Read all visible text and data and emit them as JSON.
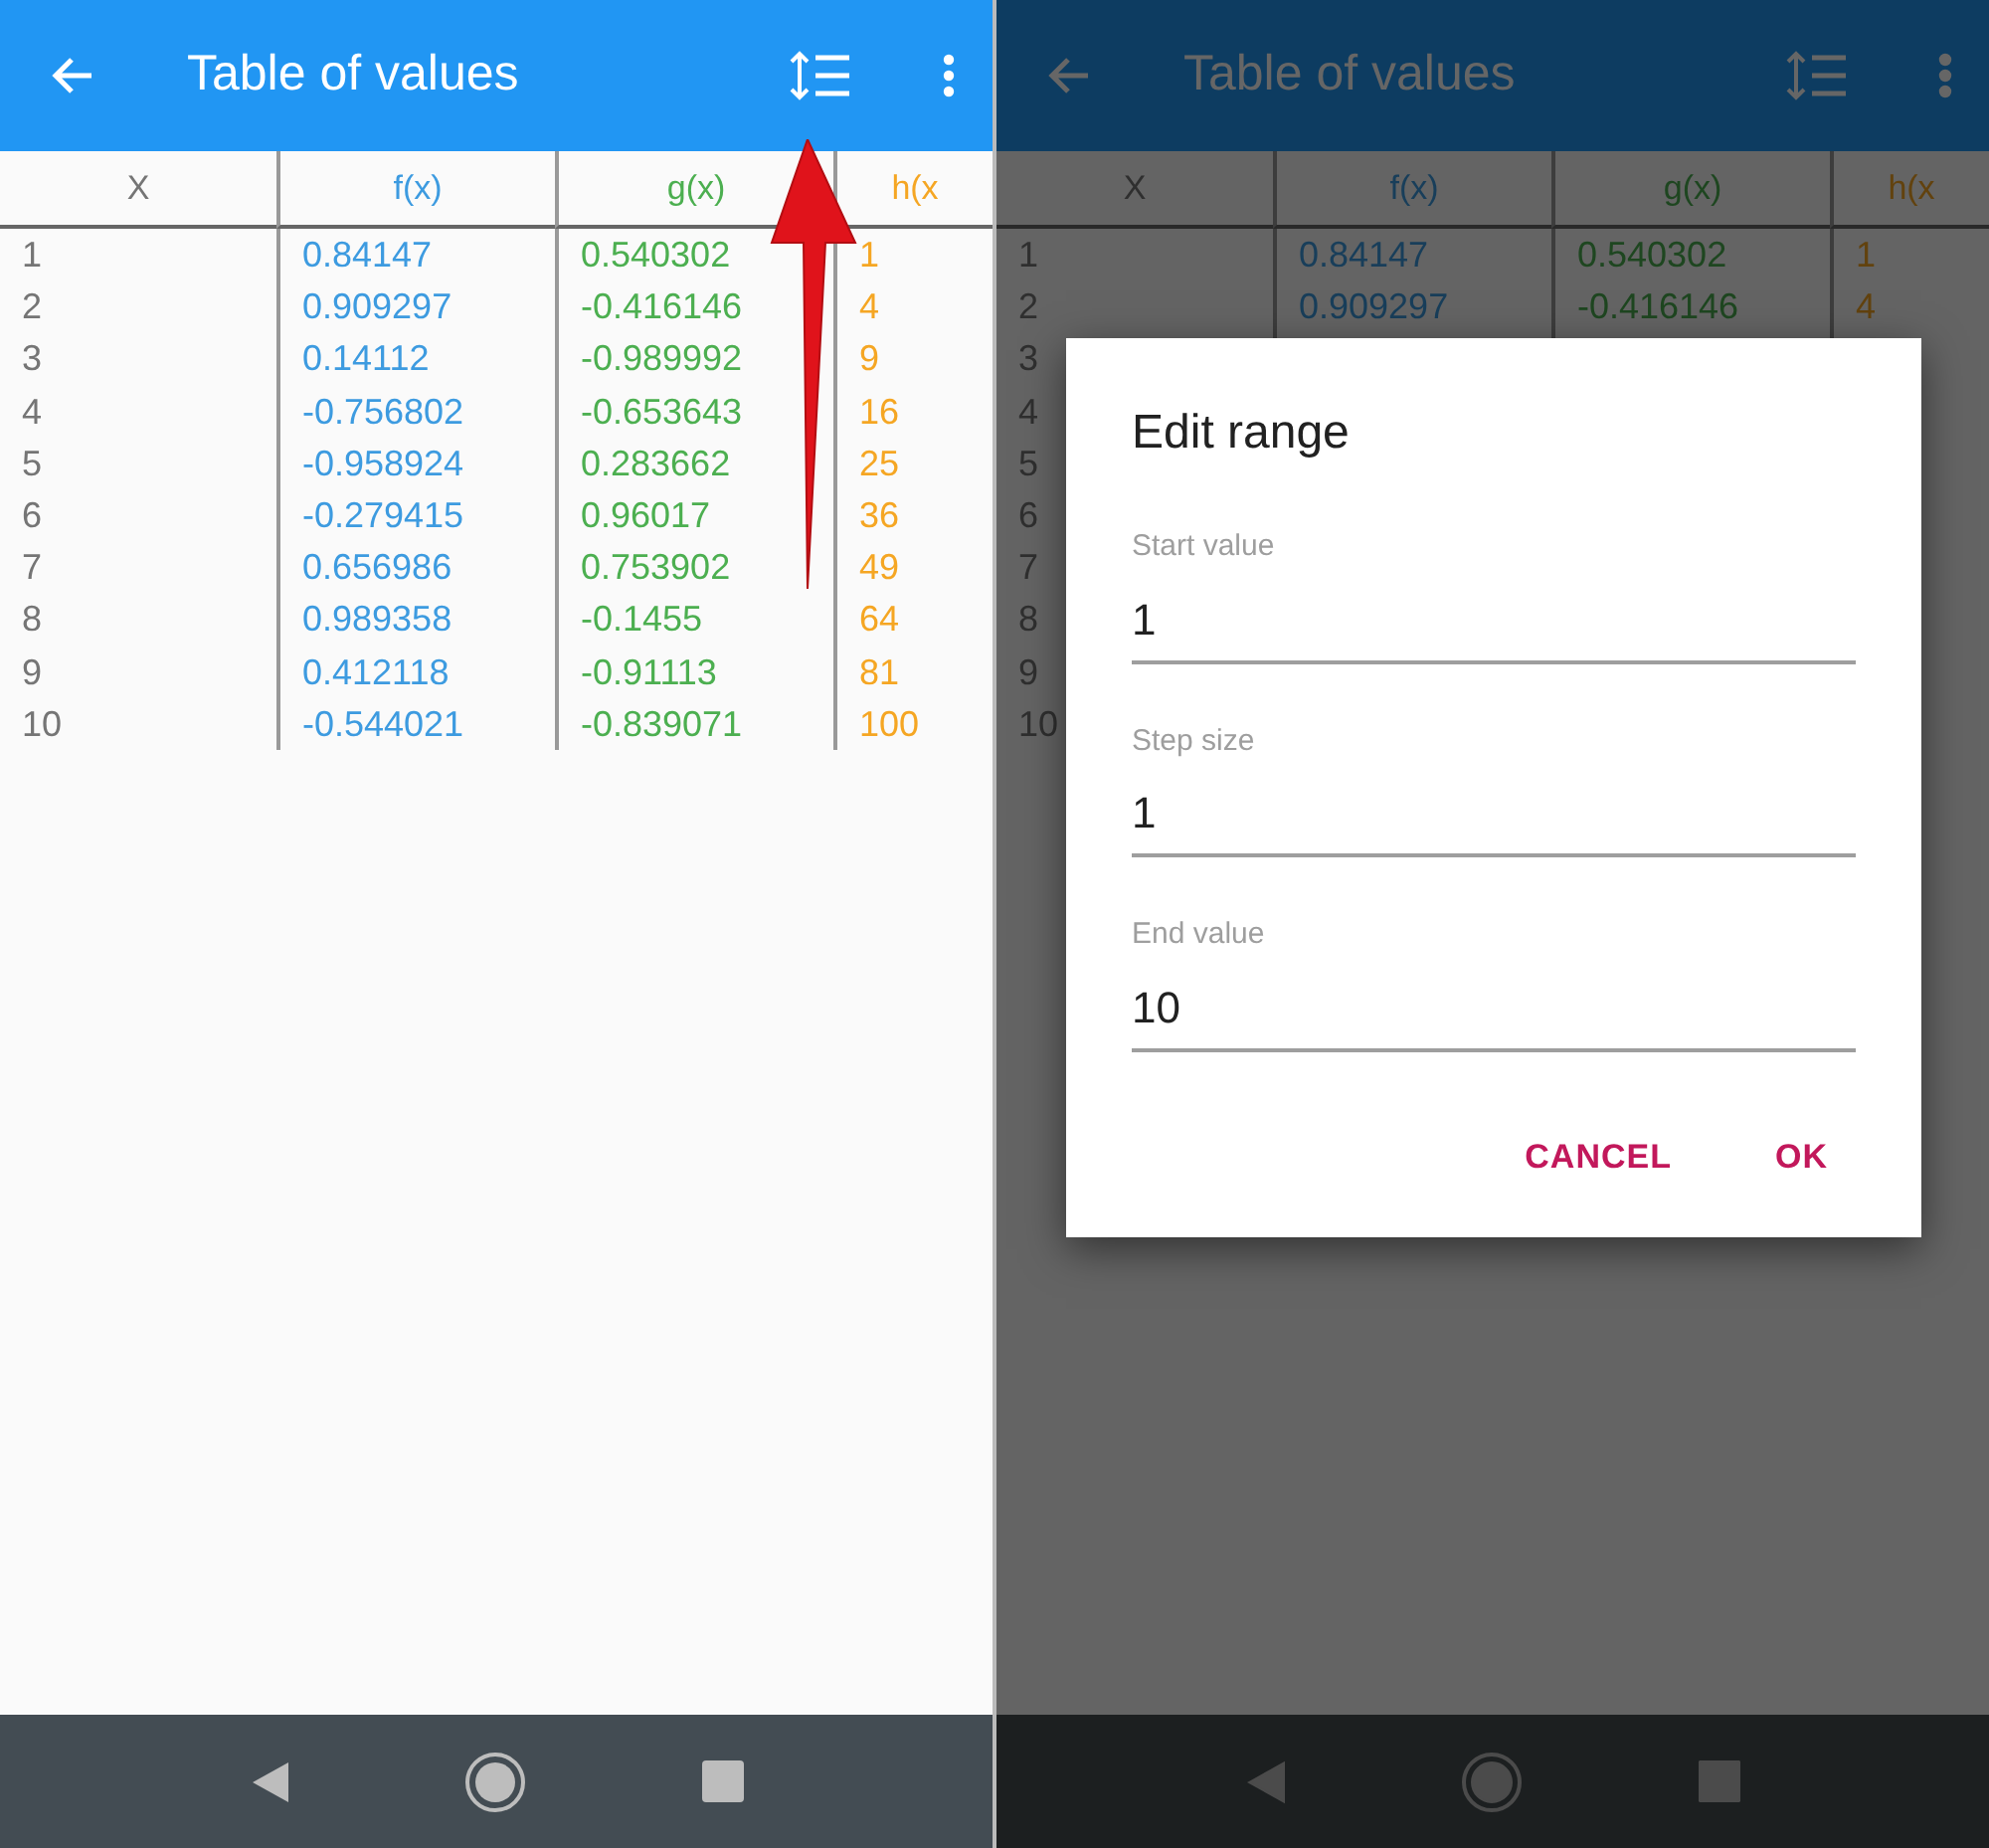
{
  "screens": [
    {
      "title": "Table of values",
      "dimmed": false,
      "columns": [
        {
          "label": "X",
          "color": "#757575"
        },
        {
          "label": "f(x)",
          "color": "#3d9be0"
        },
        {
          "label": "g(x)",
          "color": "#4caf50"
        },
        {
          "label": "h(x",
          "color": "#f5a623"
        }
      ],
      "rows": [
        [
          "1",
          "0.84147",
          "0.540302",
          "1"
        ],
        [
          "2",
          "0.909297",
          "-0.416146",
          "4"
        ],
        [
          "3",
          "0.14112",
          "-0.989992",
          "9"
        ],
        [
          "4",
          "-0.756802",
          "-0.653643",
          "16"
        ],
        [
          "5",
          "-0.958924",
          "0.283662",
          "25"
        ],
        [
          "6",
          "-0.279415",
          "0.96017",
          "36"
        ],
        [
          "7",
          "0.656986",
          "0.753902",
          "49"
        ],
        [
          "8",
          "0.989358",
          "-0.1455",
          "64"
        ],
        [
          "9",
          "0.412118",
          "-0.91113",
          "81"
        ],
        [
          "10",
          "-0.544021",
          "-0.839071",
          "100"
        ]
      ],
      "annotation": {
        "kind": "arrow"
      }
    },
    {
      "title": "Table of values",
      "dimmed": true,
      "columns": [
        {
          "label": "X",
          "color": "#2f2f2f"
        },
        {
          "label": "f(x)",
          "color": "#183e5a"
        },
        {
          "label": "g(x)",
          "color": "#1e4620"
        },
        {
          "label": "h(x",
          "color": "#62420e"
        }
      ],
      "rows": [
        [
          "1",
          "0.84147",
          "0.540302",
          "1"
        ],
        [
          "2",
          "0.909297",
          "-0.416146",
          "4"
        ],
        [
          "3"
        ],
        [
          "4"
        ],
        [
          "5"
        ],
        [
          "6"
        ],
        [
          "7"
        ],
        [
          "8"
        ],
        [
          "9"
        ],
        [
          "10"
        ]
      ],
      "dialog": {
        "title": "Edit range",
        "fields": [
          {
            "label": "Start value",
            "value": "1"
          },
          {
            "label": "Step size",
            "value": "1"
          },
          {
            "label": "End value",
            "value": "10"
          }
        ],
        "buttons": [
          "CANCEL",
          "OK"
        ]
      }
    }
  ]
}
